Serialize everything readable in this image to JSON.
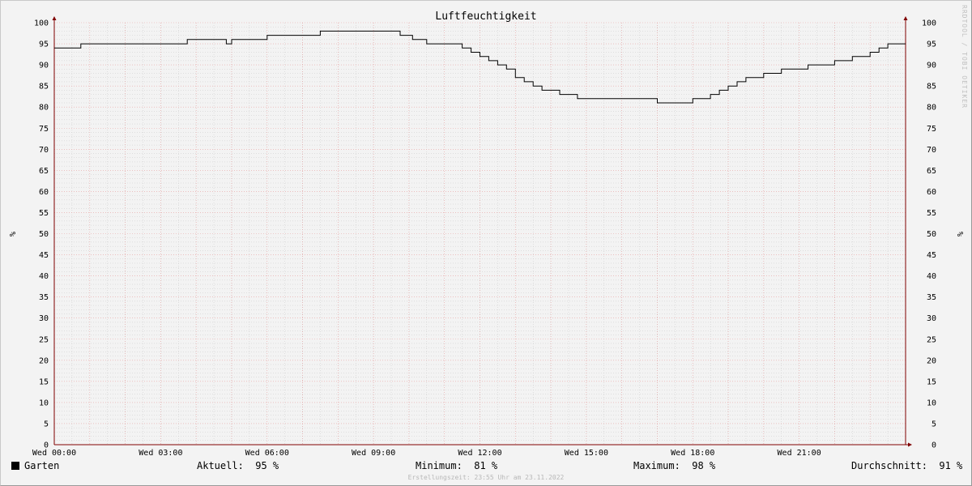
{
  "chart_data": {
    "type": "line",
    "title": "Luftfeuchtigkeit",
    "ylabel": "%",
    "ylim": [
      0,
      100
    ],
    "y_ticks": [
      0,
      5,
      10,
      15,
      20,
      25,
      30,
      35,
      40,
      45,
      50,
      55,
      60,
      65,
      70,
      75,
      80,
      85,
      90,
      95,
      100
    ],
    "x_ticks": [
      "Wed 00:00",
      "Wed 03:00",
      "Wed 06:00",
      "Wed 09:00",
      "Wed 12:00",
      "Wed 15:00",
      "Wed 18:00",
      "Wed 21:00"
    ],
    "xlim_hours": [
      0,
      24
    ],
    "grid": true,
    "legend": "bottom-left",
    "colors": {
      "line": "#000000",
      "major_grid": "#e8a0a0",
      "minor_grid": "#c8c8c8",
      "axis": "#800000"
    },
    "series": [
      {
        "name": "Garten",
        "x_hours": [
          0,
          0.75,
          3.5,
          3.75,
          4.5,
          4.85,
          5,
          5.75,
          6,
          7.5,
          9.5,
          9.75,
          10.1,
          10.5,
          11.5,
          11.75,
          12,
          12.25,
          12.5,
          12.75,
          13,
          13.25,
          13.5,
          13.75,
          14.25,
          14.75,
          15.25,
          16.25,
          17,
          18,
          18.25,
          18.5,
          18.75,
          19,
          19.25,
          19.5,
          20,
          20.5,
          21.25,
          22,
          22.5,
          23,
          23.25,
          23.5,
          24
        ],
        "values": [
          94,
          95,
          95,
          96,
          96,
          95,
          96,
          96,
          97,
          98,
          98,
          97,
          96,
          95,
          94,
          93,
          92,
          91,
          90,
          89,
          87,
          86,
          85,
          84,
          83,
          82,
          82,
          82,
          81,
          82,
          82,
          83,
          84,
          85,
          86,
          87,
          88,
          89,
          90,
          91,
          92,
          93,
          94,
          95,
          95
        ]
      }
    ]
  },
  "legend": {
    "series_name": "Garten",
    "current_label": "Aktuell:",
    "current_value": "95 %",
    "min_label": "Minimum:",
    "min_value": "81 %",
    "max_label": "Maximum:",
    "max_value": "98 %",
    "avg_label": "Durchschnitt:",
    "avg_value": "91 %"
  },
  "footer": "Erstellungszeit: 23:55 Uhr am 23.11.2022",
  "watermark": "RRDTOOL / TOBI OETIKER"
}
